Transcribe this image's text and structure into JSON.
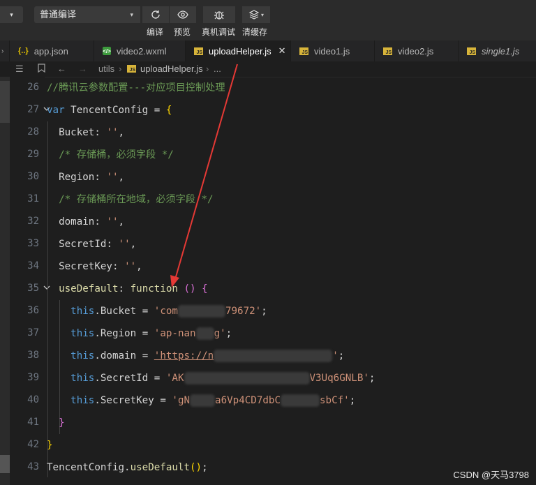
{
  "toolbar": {
    "mode_select": "普通编译",
    "buttons": [
      {
        "label": "编译",
        "icon": "refresh-icon"
      },
      {
        "label": "预览",
        "icon": "eye-icon"
      },
      {
        "label": "真机调试",
        "icon": "bug-icon"
      },
      {
        "label": "清缓存",
        "icon": "layers-icon"
      }
    ]
  },
  "tabs": [
    {
      "label": "app.json",
      "type": "json"
    },
    {
      "label": "video2.wxml",
      "type": "wxml"
    },
    {
      "label": "uploadHelper.js",
      "type": "js",
      "active": true
    },
    {
      "label": "video1.js",
      "type": "js"
    },
    {
      "label": "video2.js",
      "type": "js"
    },
    {
      "label": "single1.js",
      "type": "js",
      "italic": true
    }
  ],
  "breadcrumb": {
    "folder": "utils",
    "file": "uploadHelper.js",
    "more": "..."
  },
  "code": {
    "line_numbers": [
      "26",
      "27",
      "28",
      "29",
      "30",
      "31",
      "32",
      "33",
      "34",
      "35",
      "36",
      "37",
      "38",
      "39",
      "40",
      "41",
      "42",
      "43"
    ],
    "l26": "//腾讯云参数配置---对应项目控制处理",
    "l29": "/* 存储桶，必须字段 */",
    "l31": "/* 存储桶所在地域，必须字段 */",
    "bucket_prefix": "'com",
    "bucket_suffix": "79672'",
    "region_prefix": "'ap-nan",
    "region_suffix": "g'",
    "domain_prefix": "'https://n",
    "secretid_prefix": "'AK",
    "secretid_suffix": "V3Uq6GNLB'",
    "secretid_mid": "",
    "secretkey_prefix": "'gN",
    "secretkey_mid": "a6Vp4CD7dbC",
    "secretkey_suffix": "sbCf'"
  },
  "watermark": "CSDN @天马3798",
  "colors": {
    "comment": "#6a9955",
    "keyword": "#c586c0",
    "function": "#dcdcaa",
    "property": "#9cdcfe",
    "this": "#569cd6",
    "string": "#ce9178",
    "brace": "#ffd700",
    "arrow": "#e53935"
  }
}
